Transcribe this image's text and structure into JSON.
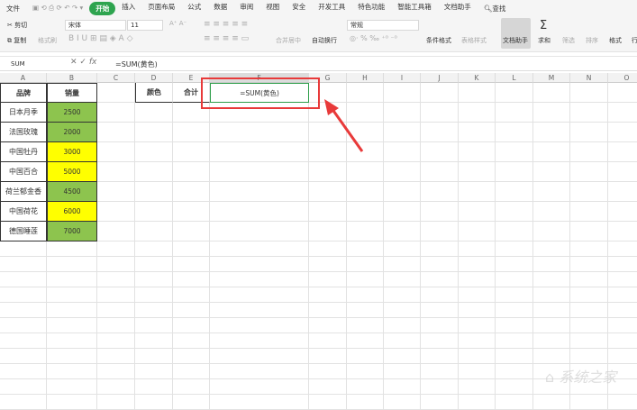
{
  "menu": {
    "file": "文件",
    "tabs": [
      "开始",
      "插入",
      "页面布局",
      "公式",
      "数据",
      "审阅",
      "视图",
      "安全",
      "开发工具",
      "特色功能",
      "智能工具箱",
      "文档助手"
    ],
    "search": "查找"
  },
  "ribbon": {
    "cut": "剪切",
    "copy": "复制",
    "format_painter": "格式刷",
    "font": "宋体",
    "size": "11",
    "merge": "合并居中",
    "wrap": "自动换行",
    "number_format": "常规",
    "cond_format": "条件格式",
    "table_style": "表格样式",
    "doc_helper": "文档助手",
    "sum": "求和",
    "filter": "筛选",
    "sort": "排序",
    "format": "格式",
    "row": "行"
  },
  "formula_bar": {
    "name_box": "SUM",
    "fx": "fx",
    "formula": "=SUM(黄色)"
  },
  "columns": [
    "A",
    "B",
    "C",
    "D",
    "E",
    "F",
    "G",
    "H",
    "I",
    "J",
    "K",
    "L",
    "M",
    "N",
    "O"
  ],
  "table": {
    "headers": [
      "品牌",
      "销量"
    ],
    "rows": [
      [
        "日本月季",
        "2500"
      ],
      [
        "法国玫瑰",
        "2000"
      ],
      [
        "中国牡丹",
        "3000"
      ],
      [
        "中国百合",
        "5000"
      ],
      [
        "荷兰郁金香",
        "4500"
      ],
      [
        "中国荷花",
        "6000"
      ],
      [
        "德国睡莲",
        "7000"
      ]
    ],
    "fill": [
      "green",
      "green",
      "yellow",
      "yellow",
      "green",
      "yellow",
      "green"
    ]
  },
  "summary": {
    "color_label": "颜色",
    "total_label": "合计",
    "active_formula": "=SUM(黄色)"
  },
  "colors": {
    "green": "#8dc44e",
    "yellow": "#ffff00",
    "accent": "#2ea44f",
    "highlight": "#e83a3a"
  },
  "watermark": "系统之家"
}
